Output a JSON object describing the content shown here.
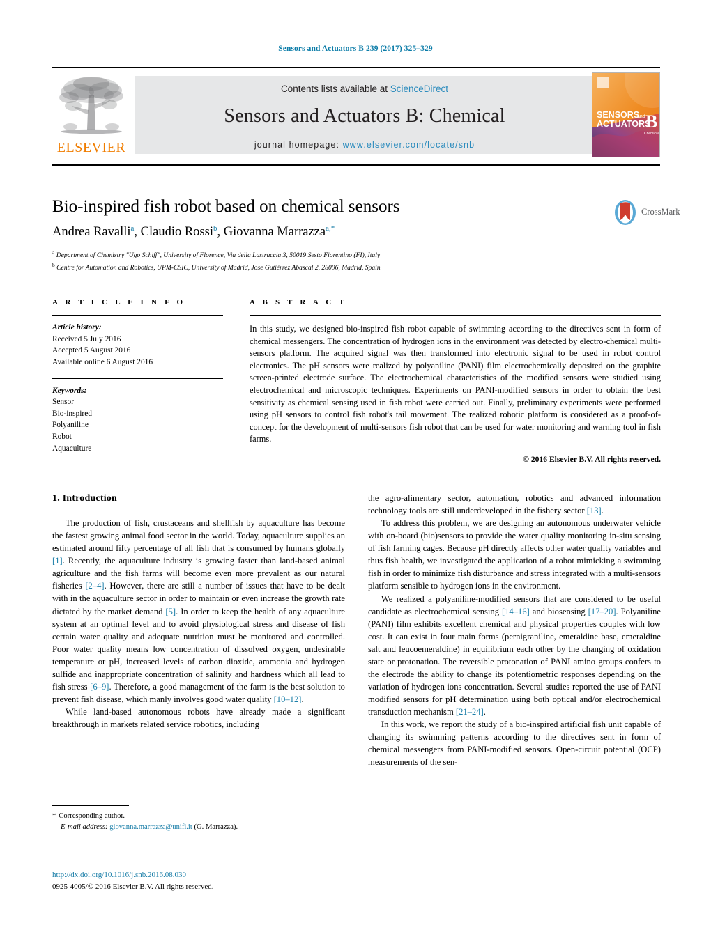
{
  "header": {
    "running_head": "Sensors and Actuators B 239 (2017) 325–329"
  },
  "masthead": {
    "publisher_name": "ELSEVIER",
    "contents_prefix": "Contents lists available at ",
    "contents_link": "ScienceDirect",
    "journal_title": "Sensors and Actuators B: Chemical",
    "homepage_prefix": "journal homepage: ",
    "homepage_url": "www.elsevier.com/locate/snb",
    "cover_line1": "SENSORS",
    "cover_and": "and",
    "cover_line2": "ACTUATORS",
    "cover_letter": "B",
    "cover_sub": "Chemical"
  },
  "article": {
    "title": "Bio-inspired fish robot based on chemical sensors",
    "authors_html": "Andrea Ravalli<sup>a</sup>, Claudio Rossi<sup>b</sup>, Giovanna Marrazza<sup>a,*</sup>",
    "affiliation_a": "Department of Chemistry \"Ugo Schiff\", University of Florence, Via della Lastruccia 3, 50019 Sesto Fiorentino (FI), Italy",
    "affiliation_b": "Centre for Automation and Robotics, UPM-CSIC, University of Madrid, Jose Gutiérrez Abascal 2, 28006, Madrid, Spain",
    "crossmark_label": "CrossMark"
  },
  "info": {
    "heading": "A R T I C L E   I N F O",
    "history_label": "Article history:",
    "history": [
      "Received 5 July 2016",
      "Accepted 5 August 2016",
      "Available online 6 August 2016"
    ],
    "keywords_label": "Keywords:",
    "keywords": [
      "Sensor",
      "Bio-inspired",
      "Polyaniline",
      "Robot",
      "Aquaculture"
    ]
  },
  "abstract": {
    "heading": "A B S T R A C T",
    "text": "In this study, we designed bio-inspired fish robot capable of swimming according to the directives sent in form of chemical messengers. The concentration of hydrogen ions in the environment was detected by electro-chemical multi-sensors platform. The acquired signal was then transformed into electronic signal to be used in robot control electronics. The pH sensors were realized by polyaniline (PANI) film electrochemically deposited on the graphite screen-printed electrode surface. The electrochemical characteristics of the modified sensors were studied using electrochemical and microscopic techniques. Experiments on PANI-modified sensors in order to obtain the best sensitivity as chemical sensing used in fish robot were carried out. Finally, preliminary experiments were performed using pH sensors to control fish robot's tail movement. The realized robotic platform is considered as a proof-of-concept for the development of multi-sensors fish robot that can be used for water monitoring and warning tool in fish farms.",
    "copyright": "© 2016 Elsevier B.V. All rights reserved."
  },
  "body": {
    "section1_heading": "1. Introduction",
    "left_paragraphs": [
      {
        "parts": [
          {
            "t": "The production of fish, crustaceans and shellfish by aquaculture has become the fastest growing animal food sector in the world. Today, aquaculture supplies an estimated around fifty percentage of all fish that is consumed by humans globally "
          },
          {
            "t": "[1]",
            "ref": true
          },
          {
            "t": ". Recently, the aquaculture industry is growing faster than land-based animal agriculture and the fish farms will become even more prevalent as our natural fisheries "
          },
          {
            "t": "[2–4]",
            "ref": true
          },
          {
            "t": ". However, there are still a number of issues that have to be dealt with in the aquaculture sector in order to maintain or even increase the growth rate dictated by the market demand "
          },
          {
            "t": "[5]",
            "ref": true
          },
          {
            "t": ". In order to keep the health of any aquaculture system at an optimal level and to avoid physiological stress and disease of fish certain water quality and adequate nutrition must be monitored and controlled. Poor water quality means low concentration of dissolved oxygen, undesirable temperature or pH, increased levels of carbon dioxide, ammonia and hydrogen sulfide and inappropriate concentration of salinity and hardness which all lead to fish stress "
          },
          {
            "t": "[6–9]",
            "ref": true
          },
          {
            "t": ". Therefore, a good management of the farm is the best solution to prevent fish disease, which manly involves good water quality "
          },
          {
            "t": "[10–12]",
            "ref": true
          },
          {
            "t": "."
          }
        ]
      },
      {
        "parts": [
          {
            "t": "While land-based autonomous robots have already made a significant breakthrough in markets related service robotics, including"
          }
        ]
      }
    ],
    "right_paragraphs": [
      {
        "noindent": true,
        "parts": [
          {
            "t": "the agro-alimentary sector, automation, robotics and advanced information technology tools are still underdeveloped in the fishery sector "
          },
          {
            "t": "[13]",
            "ref": true
          },
          {
            "t": "."
          }
        ]
      },
      {
        "parts": [
          {
            "t": "To address this problem, we are designing an autonomous underwater vehicle with on-board (bio)sensors to provide the water quality monitoring in-situ sensing of fish farming cages. Because pH directly affects other water quality variables and thus fish health, we investigated the application of a robot mimicking a swimming fish in order to minimize fish disturbance and stress integrated with a multi-sensors platform sensible to hydrogen ions in the environment."
          }
        ]
      },
      {
        "parts": [
          {
            "t": "We realized a polyaniline-modified sensors that are considered to be useful candidate as electrochemical sensing "
          },
          {
            "t": "[14–16]",
            "ref": true
          },
          {
            "t": " and biosensing "
          },
          {
            "t": "[17–20]",
            "ref": true
          },
          {
            "t": ". Polyaniline (PANI) film exhibits excellent chemical and physical properties couples with low cost. It can exist in four main forms (pernigraniline, emeraldine base, emeraldine salt and leucoemeraldine) in equilibrium each other by the changing of oxidation state or protonation. The reversible protonation of PANI amino groups confers to the electrode the ability to change its potentiometric responses depending on the variation of hydrogen ions concentration. Several studies reported the use of PANI modified sensors for pH determination using both optical and/or electrochemical transduction mechanism "
          },
          {
            "t": "[21–24]",
            "ref": true
          },
          {
            "t": "."
          }
        ]
      },
      {
        "parts": [
          {
            "t": "In this work, we report the study of a bio-inspired artificial fish unit capable of changing its swimming patterns according to the directives sent in form of chemical messengers from PANI-modified sensors. Open-circuit potential (OCP) measurements of the sen-"
          }
        ]
      }
    ]
  },
  "footnote": {
    "star": "*",
    "corresponding": "Corresponding author.",
    "email_label": "E-mail address:",
    "email": "giovanna.marrazza@unifi.it",
    "email_suffix": " (G. Marrazza)."
  },
  "footer": {
    "doi": "http://dx.doi.org/10.1016/j.snb.2016.08.030",
    "issn_line": "0925-4005/© 2016 Elsevier B.V. All rights reserved."
  },
  "colors": {
    "link_blue": "#1a7ea8",
    "sciencedirect_blue": "#2b8bbd",
    "elsevier_orange": "#f07d00",
    "masthead_gray": "#e6e7e8"
  }
}
